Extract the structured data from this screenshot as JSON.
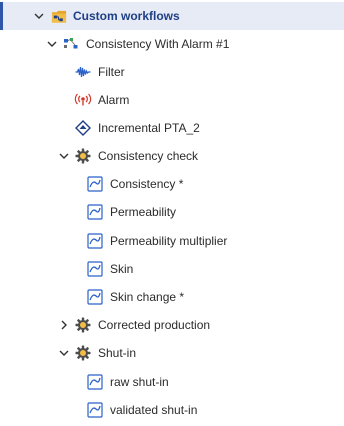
{
  "tree": {
    "root": {
      "label": "Custom workflows",
      "icon": "workflow-folder-icon",
      "expanded": true
    },
    "workflow": {
      "label": "Consistency With Alarm #1",
      "icon": "workflow-nodes-icon",
      "expanded": true
    },
    "filter": {
      "label": "Filter",
      "icon": "filter-wave-icon"
    },
    "alarm": {
      "label": "Alarm",
      "icon": "alarm-broadcast-icon"
    },
    "pta": {
      "label": "Incremental PTA_2",
      "icon": "pta-diamond-icon"
    },
    "consistency_check": {
      "label": "Consistency check",
      "icon": "gear-icon",
      "expanded": true,
      "children": [
        "Consistency *",
        "Permeability",
        "Permeability multiplier",
        "Skin",
        "Skin change *"
      ]
    },
    "corrected_production": {
      "label": "Corrected production",
      "icon": "gear-icon",
      "expanded": false
    },
    "shut_in": {
      "label": "Shut-in",
      "icon": "gear-icon",
      "expanded": true,
      "children": [
        "raw shut-in",
        "validated shut-in"
      ]
    }
  },
  "colors": {
    "selected_bg": "#e6ebf5",
    "selected_bar": "#2f56a8",
    "root_label": "#1f3f86",
    "plot_icon": "#2a62c9",
    "alarm_red": "#d33a2c",
    "gear": "#4d4d4d"
  }
}
